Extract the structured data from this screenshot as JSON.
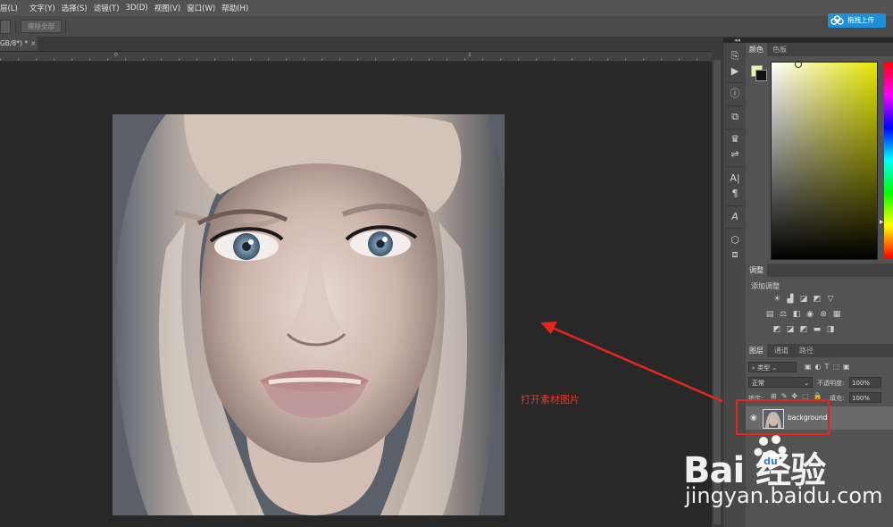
{
  "menu": [
    "层(L)",
    "文字(Y)",
    "选择(S)",
    "滤镜(T)",
    "3D(D)",
    "视图(V)",
    "窗口(W)",
    "帮助(H)"
  ],
  "options_bar": {
    "undo_all_label": "擦除全部"
  },
  "upload_button": {
    "label": "拖拽上传",
    "icon": "baidu-cloud-icon"
  },
  "document_tab": {
    "title": "GB/8*) *",
    "close": "×"
  },
  "ruler": {
    "labels": [
      "0",
      "1"
    ]
  },
  "annotation": {
    "text": "打开素材图片",
    "color": "#e53a2f"
  },
  "color_panel": {
    "tabs": [
      "颜色",
      "色板"
    ],
    "foreground": "#f2f2b0",
    "background": "#111111",
    "hue_base": "#e6e600"
  },
  "adjustments_panel": {
    "tab": "调整",
    "add_label": "添加调整"
  },
  "layers_panel": {
    "tabs": [
      "图层",
      "通道",
      "路径"
    ],
    "kind_filter": "类型",
    "blend_mode": "正常",
    "opacity_label": "不透明度:",
    "opacity_value": "100%",
    "lock_label": "锁定:",
    "fill_label": "填充:",
    "fill_value": "100%",
    "layers": [
      {
        "name": "background",
        "visible": true
      }
    ]
  },
  "highlight_color": "#e5261d",
  "watermark": {
    "logo_text": "Bai  经验",
    "url": "jingyan.baidu.com"
  }
}
